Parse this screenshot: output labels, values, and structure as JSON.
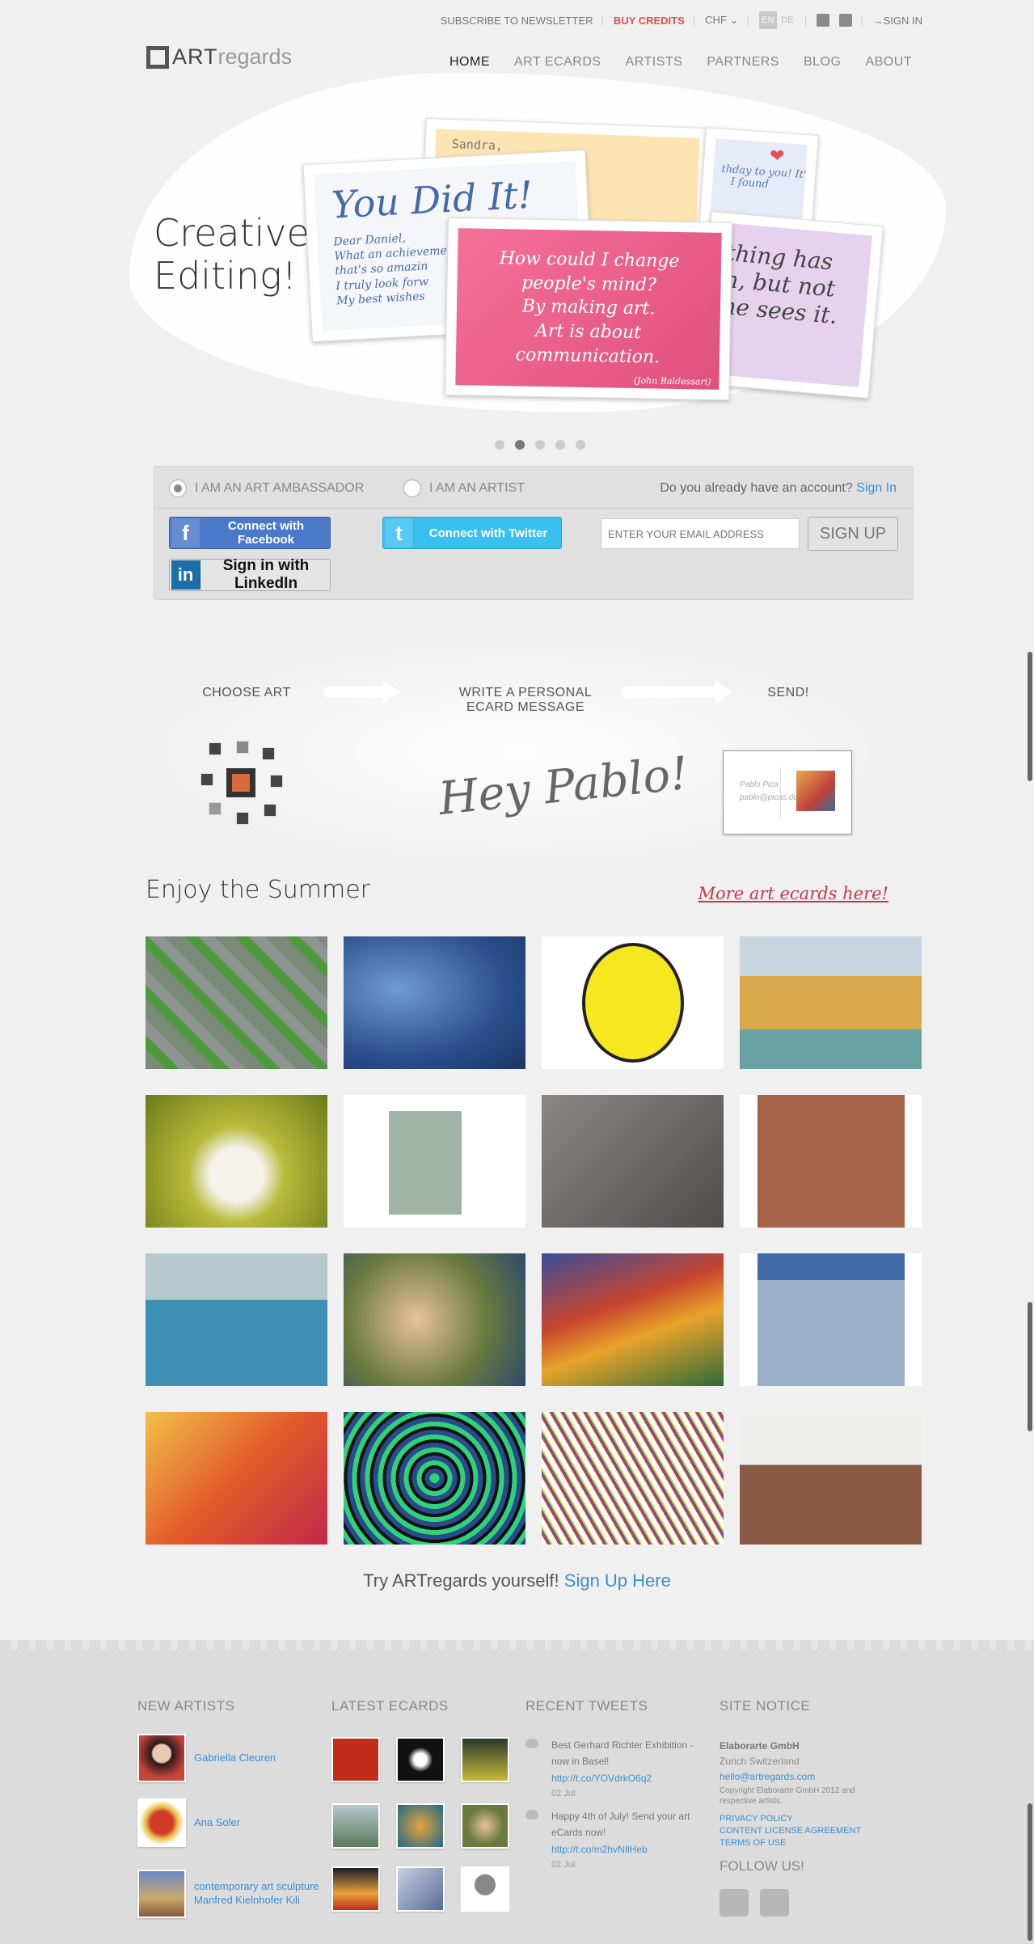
{
  "topbar": {
    "newsletter": "SUBSCRIBE TO NEWSLETTER",
    "buy_credits": "BUY CREDITS",
    "currency": "CHF",
    "lang_en": "EN",
    "lang_de": "DE",
    "sign_in": "SIGN IN"
  },
  "logo": {
    "art": "ART",
    "regards": "regards"
  },
  "nav": [
    "HOME",
    "ART ECARDS",
    "ARTISTS",
    "PARTNERS",
    "BLOG",
    "ABOUT"
  ],
  "hero": {
    "title_line1": "Creative",
    "title_line2": "Editing!",
    "card_back_text": "Sandra,\n      eptional\n   often see\n    s also",
    "card_small_text": "thday to you! It's\n   I found",
    "card_purple_text": "thing has\nn, but not\nne sees it.",
    "card_blue_big": "You Did It!",
    "card_blue_small": "Dear Daniel,\nWhat an achieveme\nthat's so amazin\nI truly look forw\nMy best wishes",
    "card_pink_text": "How could I change people's mind?\nBy making art.\nArt is about communication.",
    "card_pink_author": "(John Baldessari)"
  },
  "slider": {
    "count": 5,
    "active": 1
  },
  "signup": {
    "radio_ambassador": "I AM AN ART AMBASSADOR",
    "radio_artist": "I AM AN ARTIST",
    "already_text": "Do you already have an account?",
    "sign_in_link": "Sign In",
    "facebook": "Connect with Facebook",
    "twitter": "Connect with Twitter",
    "linkedin": "Sign in with LinkedIn",
    "email_placeholder": "ENTER YOUR EMAIL ADDRESS",
    "signup_button": "SIGN UP"
  },
  "steps": {
    "step1": "CHOOSE ART",
    "step2_line1": "WRITE A PERSONAL",
    "step2_line2": "ECARD MESSAGE",
    "step3": "SEND!",
    "handwriting": "Hey Pablo!",
    "postcard_text": "Pablo Pica\npablo@picas.de"
  },
  "gallery": {
    "title": "Enjoy the Summer",
    "more_link": "More art ecards here!"
  },
  "try": {
    "text": "Try ARTregards yourself!",
    "link": "Sign Up Here"
  },
  "footer": {
    "new_artists_title": "NEW ARTISTS",
    "latest_ecards_title": "LATEST ECARDS",
    "recent_tweets_title": "RECENT TWEETS",
    "site_notice_title": "SITE NOTICE",
    "artists": [
      {
        "name": "Gabriella Cleuren"
      },
      {
        "name": "Ana Soler"
      },
      {
        "name": "contemporary art sculpture Manfred Kielnhofer Kili"
      }
    ],
    "tweets": [
      {
        "text": "Best Gerhard Richter Exhibition - now in Basel!",
        "link": "http://t.co/YOVdrkO6q2",
        "date": "02 Jul"
      },
      {
        "text": "Happy 4th of July! Send your art eCards now!",
        "link": "http://t.co/m2hvNIlHeb",
        "date": "02 Jul"
      }
    ],
    "notice": {
      "company": "Elaborarte GmbH",
      "location": "Zurich   Switzerland",
      "email": "hello@artregards.com",
      "copyright": "Copyright Elaborarte GmbH 2012 and respective artists.",
      "privacy": "PRIVACY POLICY",
      "license": "CONTENT LICENSE AGREEMENT",
      "terms": "TERMS OF USE"
    },
    "follow": "FOLLOW US!"
  },
  "colors": {
    "accent_link": "#3a8fd0",
    "buy_credits": "#d9534f",
    "facebook": "#4b79c9",
    "twitter": "#39c0ef",
    "linkedin": "#1a6fa8",
    "more_link": "#c0394a"
  }
}
